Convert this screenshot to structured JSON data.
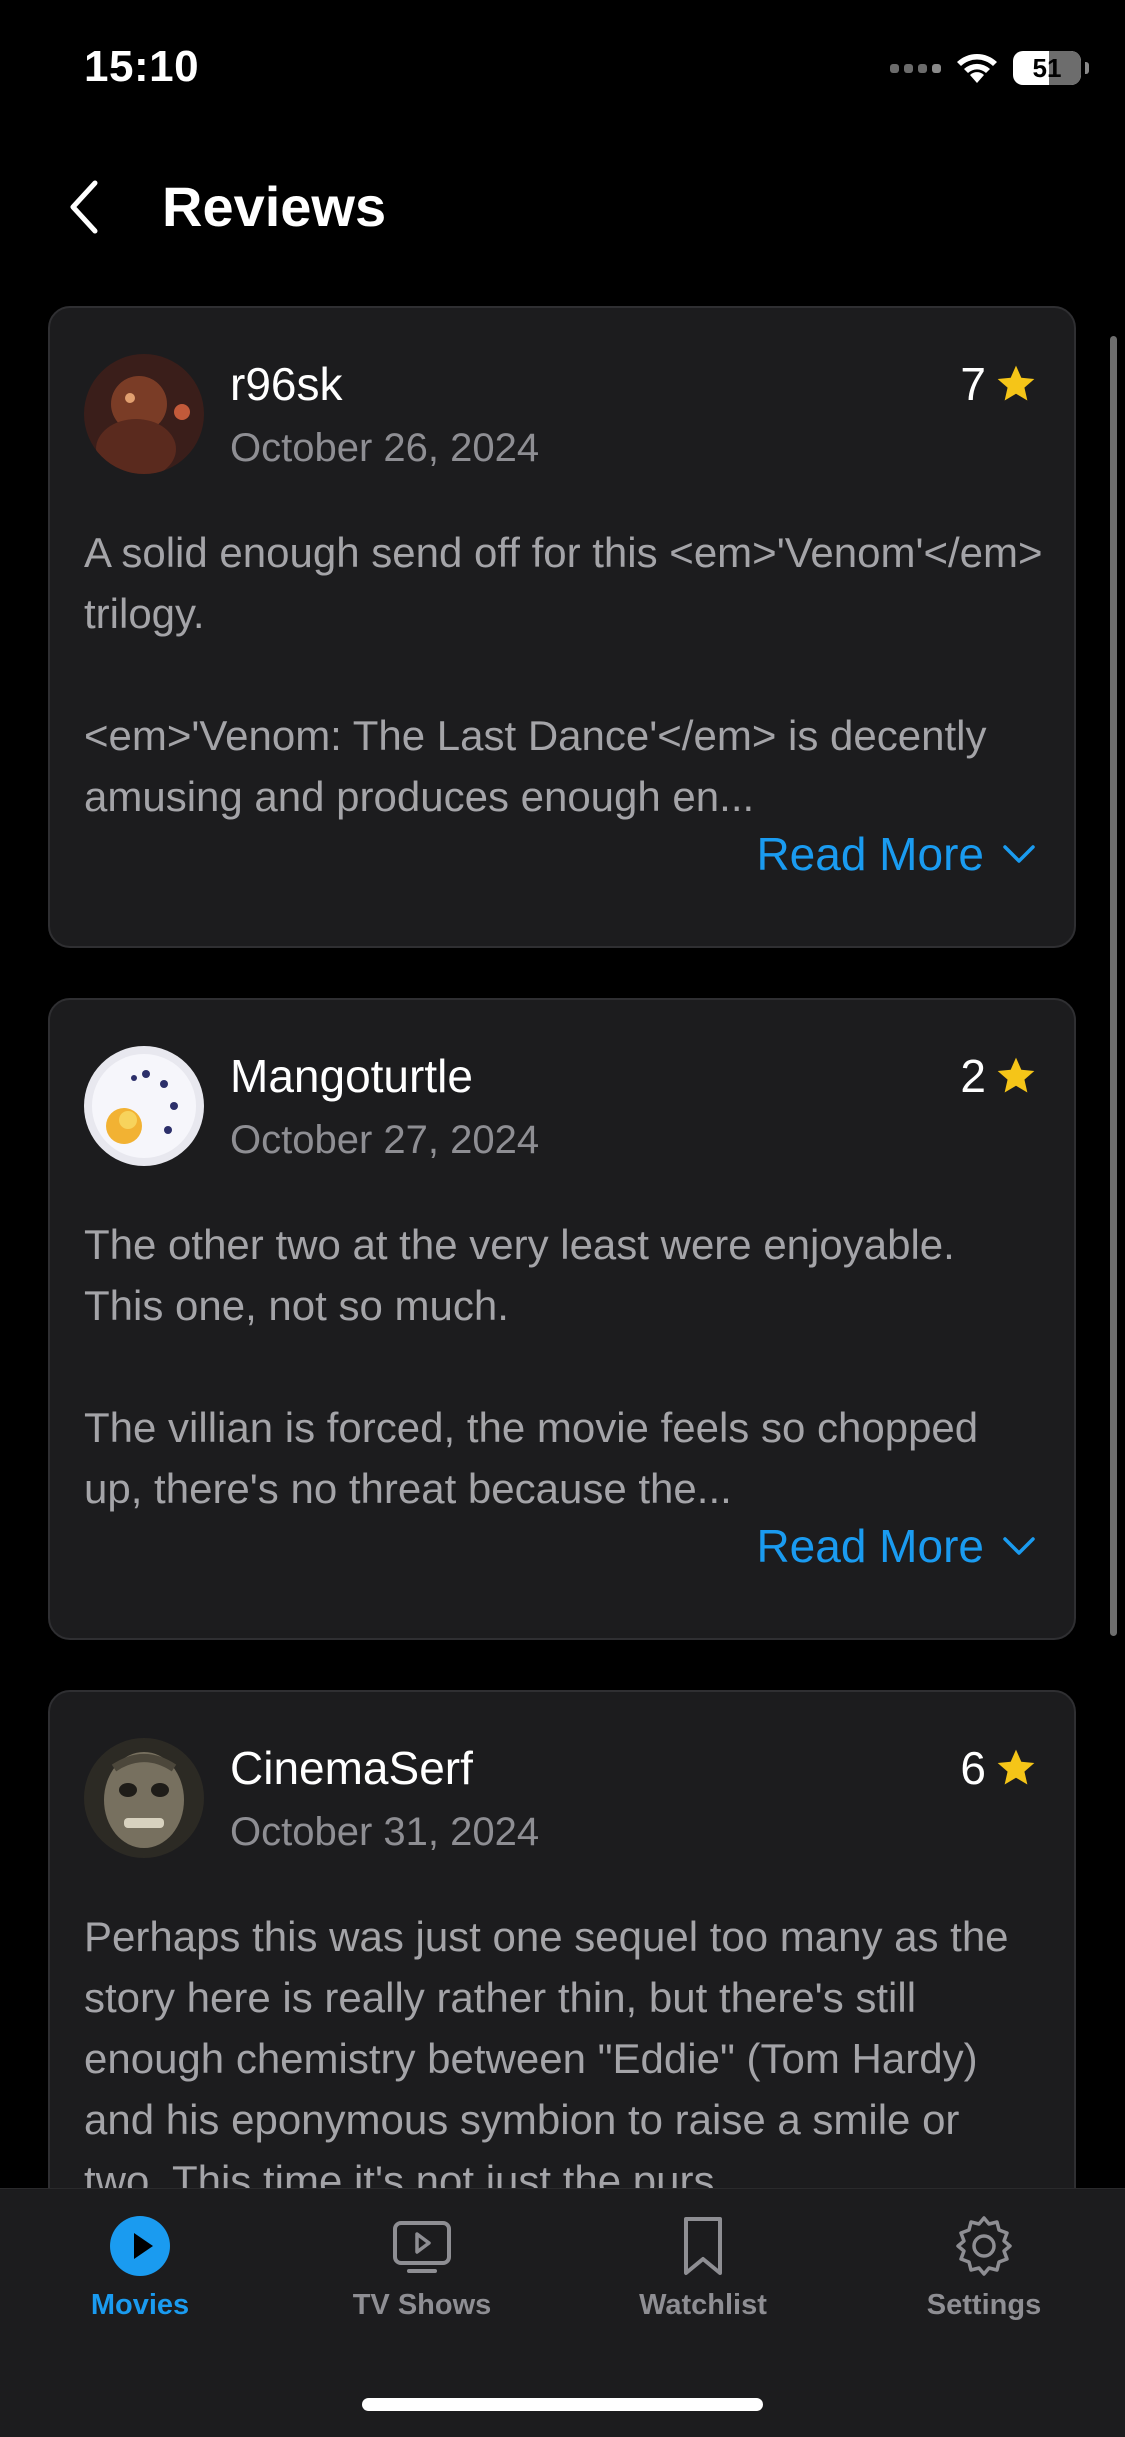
{
  "status_bar": {
    "time": "15:10",
    "battery": "51"
  },
  "header": {
    "title": "Reviews",
    "back_icon": "chevron-left-icon"
  },
  "reviews": [
    {
      "author": "r96sk",
      "date": "October 26, 2024",
      "rating": "7",
      "text": "A solid enough send off for this <em>'Venom'</em> trilogy.\n\n<em>'Venom: The Last Dance'</em> is decently amusing and produces enough en...",
      "read_more": "Read More"
    },
    {
      "author": "Mangoturtle",
      "date": "October 27, 2024",
      "rating": "2",
      "text": "The other two at the very least were enjoyable. This one, not so much.\n\nThe villian is forced, the movie feels so chopped up, there's no threat because the...",
      "read_more": "Read More"
    },
    {
      "author": "CinemaSerf",
      "date": "October 31, 2024",
      "rating": "6",
      "text": "Perhaps this was just one sequel too many as the story here is really rather thin, but there's still enough chemistry between \"Eddie\" (Tom Hardy) and his eponymous symbion to raise a smile or two. This time it's not just the purs",
      "read_more": ""
    }
  ],
  "tab_bar": {
    "tabs": [
      {
        "label": "Movies",
        "icon": "play-circle-icon",
        "active": true
      },
      {
        "label": "TV Shows",
        "icon": "tv-icon",
        "active": false
      },
      {
        "label": "Watchlist",
        "icon": "bookmark-icon",
        "active": false
      },
      {
        "label": "Settings",
        "icon": "gear-icon",
        "active": false
      }
    ]
  },
  "colors": {
    "background": "#000000",
    "card": "#1c1c1e",
    "accent": "#1a9bf0",
    "star": "#f5c518",
    "muted_text": "#8e8e93"
  }
}
